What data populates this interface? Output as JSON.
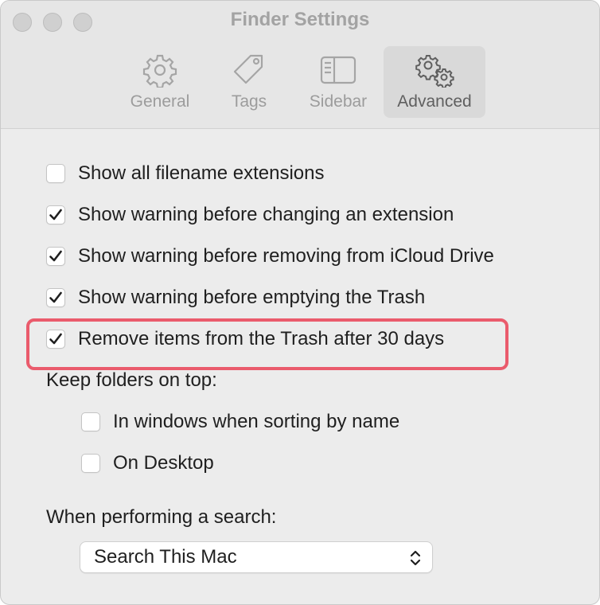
{
  "window": {
    "title": "Finder Settings"
  },
  "tabs": [
    {
      "label": "General",
      "icon": "gear-icon",
      "selected": false
    },
    {
      "label": "Tags",
      "icon": "tag-icon",
      "selected": false
    },
    {
      "label": "Sidebar",
      "icon": "sidebar-icon",
      "selected": false
    },
    {
      "label": "Advanced",
      "icon": "gears-icon",
      "selected": true
    }
  ],
  "options": [
    {
      "label": "Show all filename extensions",
      "checked": false
    },
    {
      "label": "Show warning before changing an extension",
      "checked": true
    },
    {
      "label": "Show warning before removing from iCloud Drive",
      "checked": true
    },
    {
      "label": "Show warning before emptying the Trash",
      "checked": true
    },
    {
      "label": "Remove items from the Trash after 30 days",
      "checked": true
    }
  ],
  "folders_on_top": {
    "heading": "Keep folders on top:",
    "options": [
      {
        "label": "In windows when sorting by name",
        "checked": false
      },
      {
        "label": "On Desktop",
        "checked": false
      }
    ]
  },
  "search": {
    "heading": "When performing a search:",
    "selected": "Search This Mac"
  },
  "colors": {
    "highlight": "#ea5b6c",
    "window_bg": "#ececec"
  }
}
